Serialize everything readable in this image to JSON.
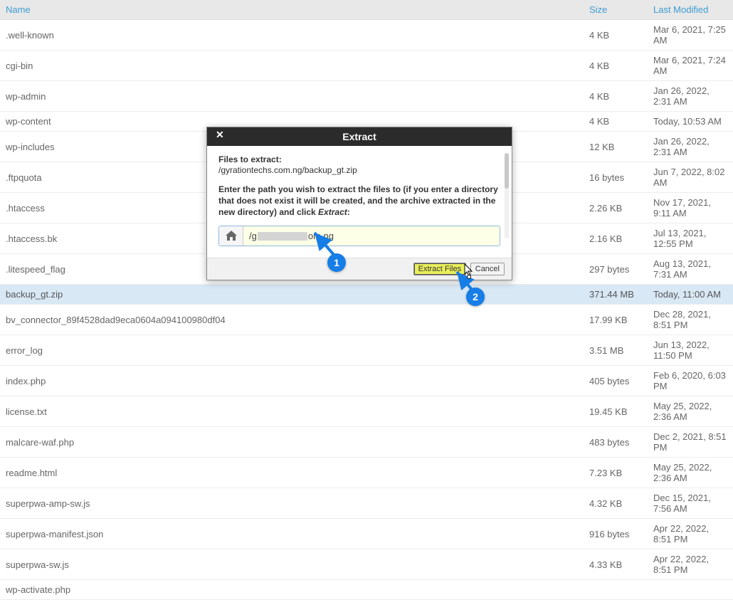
{
  "columns": {
    "name": "Name",
    "size": "Size",
    "modified": "Last Modified"
  },
  "rows": [
    {
      "name": ".well-known",
      "size": "4 KB",
      "modified": "Mar 6, 2021, 7:25 AM",
      "sel": false
    },
    {
      "name": "cgi-bin",
      "size": "4 KB",
      "modified": "Mar 6, 2021, 7:24 AM",
      "sel": false
    },
    {
      "name": "wp-admin",
      "size": "4 KB",
      "modified": "Jan 26, 2022, 2:31 AM",
      "sel": false
    },
    {
      "name": "wp-content",
      "size": "4 KB",
      "modified": "Today, 10:53 AM",
      "sel": false
    },
    {
      "name": "wp-includes",
      "size": "12 KB",
      "modified": "Jan 26, 2022, 2:31 AM",
      "sel": false
    },
    {
      "name": ".ftpquota",
      "size": "16 bytes",
      "modified": "Jun 7, 2022, 8:02 AM",
      "sel": false
    },
    {
      "name": ".htaccess",
      "size": "2.26 KB",
      "modified": "Nov 17, 2021, 9:11 AM",
      "sel": false
    },
    {
      "name": ".htaccess.bk",
      "size": "2.16 KB",
      "modified": "Jul 13, 2021, 12:55 PM",
      "sel": false
    },
    {
      "name": ".litespeed_flag",
      "size": "297 bytes",
      "modified": "Aug 13, 2021, 7:31 AM",
      "sel": false
    },
    {
      "name": "backup_gt.zip",
      "size": "371.44 MB",
      "modified": "Today, 11:00 AM",
      "sel": true
    },
    {
      "name": "bv_connector_89f4528dad9eca0604a094100980df04",
      "size": "17.99 KB",
      "modified": "Dec 28, 2021, 8:51 PM",
      "sel": false
    },
    {
      "name": "error_log",
      "size": "3.51 MB",
      "modified": "Jun 13, 2022, 11:50 PM",
      "sel": false
    },
    {
      "name": "index.php",
      "size": "405 bytes",
      "modified": "Feb 6, 2020, 6:03 PM",
      "sel": false
    },
    {
      "name": "license.txt",
      "size": "19.45 KB",
      "modified": "May 25, 2022, 2:36 AM",
      "sel": false
    },
    {
      "name": "malcare-waf.php",
      "size": "483 bytes",
      "modified": "Dec 2, 2021, 8:51 PM",
      "sel": false
    },
    {
      "name": "readme.html",
      "size": "7.23 KB",
      "modified": "May 25, 2022, 2:36 AM",
      "sel": false
    },
    {
      "name": "superpwa-amp-sw.js",
      "size": "4.32 KB",
      "modified": "Dec 15, 2021, 7:56 AM",
      "sel": false
    },
    {
      "name": "superpwa-manifest.json",
      "size": "916 bytes",
      "modified": "Apr 22, 2022, 8:51 PM",
      "sel": false
    },
    {
      "name": "superpwa-sw.js",
      "size": "4.33 KB",
      "modified": "Apr 22, 2022, 8:51 PM",
      "sel": false
    },
    {
      "name": "wp-activate.php",
      "size": "",
      "modified": "",
      "sel": false
    }
  ],
  "dialog": {
    "title": "Extract",
    "files_label": "Files to extract:",
    "files_path": "/gyrationtechs.com.ng/backup_gt.zip",
    "instruction_pre": "Enter the path you wish to extract the files to (if you enter a directory that does not exist it will be created, and the archive extracted in the new directory) and click ",
    "instruction_em": "Extract",
    "instruction_post": ":",
    "input_value_prefix": "/g",
    "input_value_suffix": "om.ng",
    "extract_btn": "Extract Files",
    "cancel_btn": "Cancel"
  },
  "callouts": {
    "c1": "1",
    "c2": "2"
  }
}
